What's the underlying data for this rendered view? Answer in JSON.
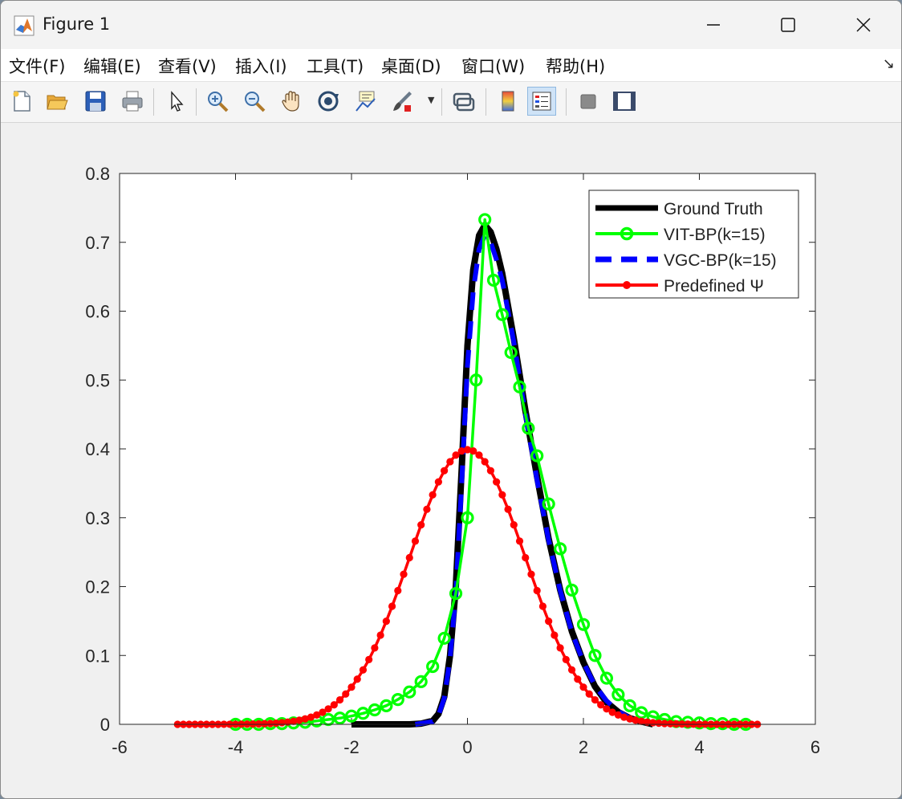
{
  "window": {
    "title": "Figure 1",
    "controls": {
      "minimize": "minimize-icon",
      "maximize": "maximize-icon",
      "close": "close-icon"
    }
  },
  "menu": {
    "items": [
      "文件(F)",
      "编辑(E)",
      "查看(V)",
      "插入(I)",
      "工具(T)",
      "桌面(D)",
      "窗口(W)",
      "帮助(H)"
    ],
    "dock_icon": "↘"
  },
  "toolbar": {
    "icons": [
      "new-figure-icon",
      "open-icon",
      "save-icon",
      "print-icon",
      "select-arrow-icon",
      "zoom-in-icon",
      "zoom-out-icon",
      "pan-hand-icon",
      "rotate-3d-icon",
      "data-cursor-icon",
      "brush-icon",
      "link-plot-icon",
      "colorbar-icon",
      "legend-icon",
      "hide-plot-tools-icon",
      "show-plot-tools-icon"
    ]
  },
  "colors": {
    "ground_truth": "#000000",
    "vit_bp": "#00ff00",
    "vgc_bp": "#0000ff",
    "predefined": "#ff0000"
  },
  "chart_data": {
    "type": "line",
    "title": "",
    "xlabel": "",
    "ylabel": "",
    "xlim": [
      -6,
      6
    ],
    "ylim": [
      0,
      0.8
    ],
    "xticks": [
      "-6",
      "-4",
      "-2",
      "0",
      "2",
      "4",
      "6"
    ],
    "yticks": [
      "0",
      "0.1",
      "0.2",
      "0.3",
      "0.4",
      "0.5",
      "0.6",
      "0.7",
      "0.8"
    ],
    "legend_position": "top-right",
    "legend": [
      "Ground Truth",
      "VIT-BP(k=15)",
      "VGC-BP(k=15)",
      "Predefined Ψ"
    ],
    "series": [
      {
        "name": "Ground Truth",
        "style": "solid-thick",
        "x": [
          -2.0,
          -1.0,
          -0.8,
          -0.6,
          -0.5,
          -0.4,
          -0.3,
          -0.2,
          -0.1,
          0.0,
          0.1,
          0.2,
          0.3,
          0.4,
          0.5,
          0.6,
          0.8,
          1.0,
          1.2,
          1.4,
          1.6,
          1.8,
          2.0,
          2.2,
          2.4,
          2.6,
          2.8,
          3.0,
          3.2
        ],
        "y": [
          0.0,
          0.0,
          0.001,
          0.005,
          0.015,
          0.04,
          0.1,
          0.2,
          0.37,
          0.55,
          0.66,
          0.71,
          0.725,
          0.715,
          0.69,
          0.655,
          0.56,
          0.455,
          0.36,
          0.27,
          0.195,
          0.135,
          0.09,
          0.055,
          0.032,
          0.018,
          0.009,
          0.004,
          0.0
        ]
      },
      {
        "name": "VGC-BP(k=15)",
        "style": "dashed",
        "x": [
          -0.9,
          -0.6,
          -0.5,
          -0.4,
          -0.3,
          -0.2,
          -0.1,
          0.0,
          0.1,
          0.2,
          0.3,
          0.4,
          0.5,
          0.6,
          0.8,
          1.0,
          1.2,
          1.4,
          1.6,
          1.8,
          2.0,
          2.2,
          2.4,
          2.6,
          2.8,
          3.0
        ],
        "y": [
          0.0,
          0.004,
          0.013,
          0.038,
          0.095,
          0.19,
          0.35,
          0.52,
          0.63,
          0.69,
          0.71,
          0.7,
          0.675,
          0.645,
          0.555,
          0.45,
          0.355,
          0.268,
          0.194,
          0.134,
          0.09,
          0.056,
          0.034,
          0.019,
          0.009,
          0.003
        ]
      },
      {
        "name": "VIT-BP(k=15)",
        "style": "solid-circles",
        "x": [
          -4.0,
          -3.8,
          -3.6,
          -3.4,
          -3.2,
          -3.0,
          -2.8,
          -2.6,
          -2.4,
          -2.2,
          -2.0,
          -1.8,
          -1.6,
          -1.4,
          -1.2,
          -1.0,
          -0.8,
          -0.6,
          -0.4,
          -0.2,
          0.0,
          0.15,
          0.3,
          0.45,
          0.6,
          0.75,
          0.9,
          1.05,
          1.2,
          1.4,
          1.6,
          1.8,
          2.0,
          2.2,
          2.4,
          2.6,
          2.8,
          3.0,
          3.2,
          3.4,
          3.6,
          3.8,
          4.0,
          4.2,
          4.4,
          4.6,
          4.8
        ],
        "y": [
          0.0,
          0.0,
          0.0,
          0.001,
          0.001,
          0.002,
          0.003,
          0.005,
          0.007,
          0.009,
          0.012,
          0.016,
          0.021,
          0.027,
          0.036,
          0.047,
          0.062,
          0.084,
          0.125,
          0.19,
          0.3,
          0.5,
          0.733,
          0.645,
          0.595,
          0.54,
          0.49,
          0.43,
          0.39,
          0.32,
          0.255,
          0.195,
          0.145,
          0.1,
          0.067,
          0.043,
          0.027,
          0.017,
          0.011,
          0.007,
          0.004,
          0.003,
          0.002,
          0.001,
          0.001,
          0.0,
          0.0
        ]
      },
      {
        "name": "Predefined Ψ",
        "style": "solid-dots",
        "x": [
          -5.0,
          -4.9,
          -4.8,
          -4.7,
          -4.6,
          -4.5,
          -4.4,
          -4.3,
          -4.2,
          -4.1,
          -4.0,
          -3.9,
          -3.8,
          -3.7,
          -3.6,
          -3.5,
          -3.4,
          -3.3,
          -3.2,
          -3.1,
          -3.0,
          -2.9,
          -2.8,
          -2.7,
          -2.6,
          -2.5,
          -2.4,
          -2.3,
          -2.2,
          -2.1,
          -2.0,
          -1.9,
          -1.8,
          -1.7,
          -1.6,
          -1.5,
          -1.4,
          -1.3,
          -1.2,
          -1.1,
          -1.0,
          -0.9,
          -0.8,
          -0.7,
          -0.6,
          -0.5,
          -0.4,
          -0.3,
          -0.2,
          -0.1,
          0.0,
          0.1,
          0.2,
          0.3,
          0.4,
          0.5,
          0.6,
          0.7,
          0.8,
          0.9,
          1.0,
          1.1,
          1.2,
          1.3,
          1.4,
          1.5,
          1.6,
          1.7,
          1.8,
          1.9,
          2.0,
          2.1,
          2.2,
          2.3,
          2.4,
          2.5,
          2.6,
          2.7,
          2.8,
          2.9,
          3.0,
          3.1,
          3.2,
          3.3,
          3.4,
          3.5,
          3.6,
          3.7,
          3.8,
          3.9,
          4.0,
          4.1,
          4.2,
          4.3,
          4.4,
          4.5,
          4.6,
          4.7,
          4.8,
          4.9,
          5.0
        ],
        "y": [
          0.0,
          0.0,
          0.0,
          0.0,
          0.0,
          0.0,
          0.0,
          0.0,
          0.0001,
          0.0001,
          0.0001,
          0.0002,
          0.0003,
          0.0004,
          0.0006,
          0.0009,
          0.0012,
          0.0017,
          0.0024,
          0.0033,
          0.0044,
          0.006,
          0.0079,
          0.0104,
          0.0136,
          0.0175,
          0.0224,
          0.0283,
          0.0355,
          0.044,
          0.054,
          0.0656,
          0.079,
          0.094,
          0.1109,
          0.1295,
          0.1497,
          0.1714,
          0.1942,
          0.2179,
          0.242,
          0.2661,
          0.2897,
          0.3123,
          0.3332,
          0.3521,
          0.3683,
          0.3814,
          0.391,
          0.397,
          0.3989,
          0.397,
          0.391,
          0.3814,
          0.3683,
          0.3521,
          0.3332,
          0.3123,
          0.2897,
          0.2661,
          0.242,
          0.2179,
          0.1942,
          0.1714,
          0.1497,
          0.1295,
          0.1109,
          0.094,
          0.079,
          0.0656,
          0.054,
          0.044,
          0.0355,
          0.0283,
          0.0224,
          0.0175,
          0.0136,
          0.0104,
          0.0079,
          0.006,
          0.0044,
          0.0033,
          0.0024,
          0.0017,
          0.0012,
          0.0009,
          0.0006,
          0.0004,
          0.0003,
          0.0002,
          0.0001,
          0.0001,
          0.0001,
          0.0,
          0.0,
          0.0,
          0.0,
          0.0,
          0.0,
          0.0,
          0.0
        ]
      }
    ]
  }
}
